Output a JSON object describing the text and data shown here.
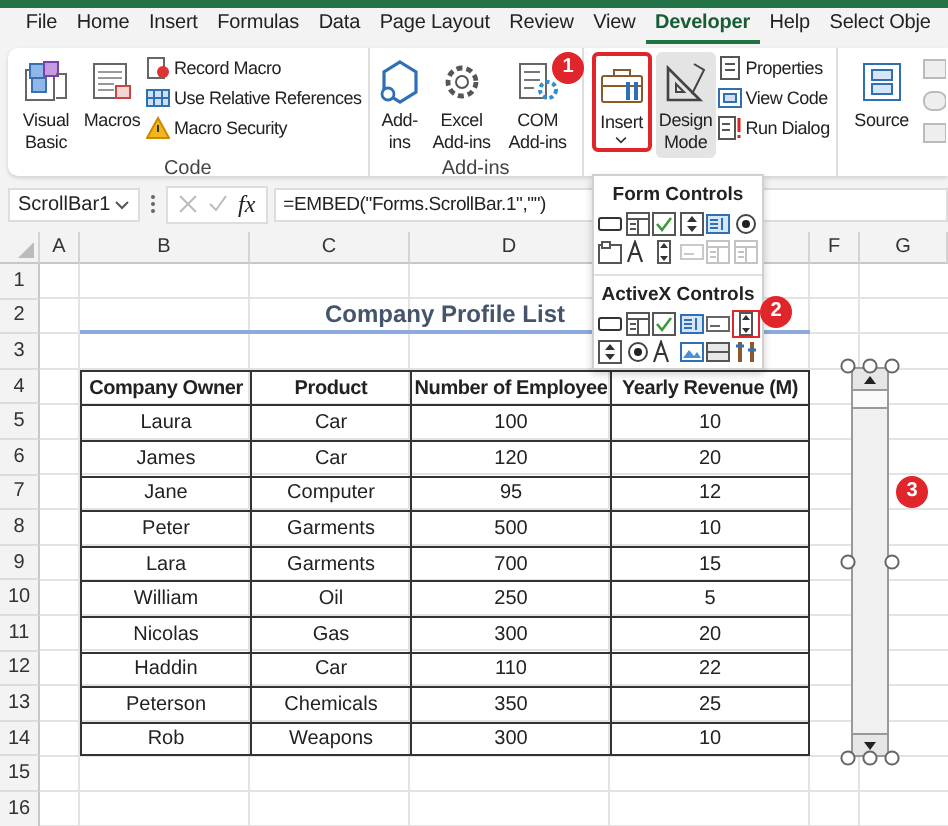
{
  "menu_tabs": [
    {
      "label": "File",
      "selected": false
    },
    {
      "label": "Home",
      "selected": false
    },
    {
      "label": "Insert",
      "selected": false
    },
    {
      "label": "Formulas",
      "selected": false
    },
    {
      "label": "Data",
      "selected": false
    },
    {
      "label": "Page Layout",
      "selected": false
    },
    {
      "label": "Review",
      "selected": false
    },
    {
      "label": "View",
      "selected": false
    },
    {
      "label": "Developer",
      "selected": true
    },
    {
      "label": "Help",
      "selected": false
    },
    {
      "label": "Select Obje",
      "selected": false
    }
  ],
  "ribbon_groups": [
    {
      "label": "Code",
      "large_buttons": [
        {
          "label": "Visual Basic"
        },
        {
          "label": "Macros"
        }
      ],
      "small_buttons": [
        {
          "label": "Record Macro"
        },
        {
          "label": "Use Relative References"
        },
        {
          "label": "Macro Security"
        }
      ]
    },
    {
      "label": "Add-ins",
      "large_buttons": [
        {
          "label": "Add-ins"
        },
        {
          "label": "Excel Add-ins"
        },
        {
          "label": "COM Add-ins"
        }
      ]
    },
    {
      "large_buttons": [
        {
          "label": "Insert",
          "dropdown": true,
          "highlighted": true,
          "selected": false
        },
        {
          "label": "Design Mode",
          "dropdown": false,
          "highlighted": false,
          "selected": true
        }
      ],
      "small_buttons": [
        {
          "label": "Properties"
        },
        {
          "label": "View Code"
        },
        {
          "label": "Run Dialog"
        }
      ]
    },
    {
      "large_buttons": [
        {
          "label": "Source"
        }
      ]
    }
  ],
  "formula_bar": {
    "name_box": "ScrollBar1",
    "function_label": "fx",
    "formula": "=EMBED(\"Forms.ScrollBar.1\",\"\")"
  },
  "sheet": {
    "column_headers": [
      "A",
      "B",
      "C",
      "D",
      "F",
      "G"
    ],
    "row_numbers": [
      "1",
      "2",
      "3",
      "4",
      "5",
      "6",
      "7",
      "8",
      "9",
      "10",
      "11",
      "12",
      "13",
      "14",
      "15",
      "16"
    ],
    "title": "Company Profile List",
    "table": {
      "columns": [
        "Company Owner",
        "Product",
        "Number of Employee",
        "Yearly Revenue (M)"
      ],
      "rows": [
        [
          "Laura",
          "Car",
          "100",
          "10"
        ],
        [
          "James",
          "Car",
          "120",
          "20"
        ],
        [
          "Jane",
          "Computer",
          "95",
          "12"
        ],
        [
          "Peter",
          "Garments",
          "500",
          "10"
        ],
        [
          "Lara",
          "Garments",
          "700",
          "15"
        ],
        [
          "William",
          "Oil",
          "250",
          "5"
        ],
        [
          "Nicolas",
          "Gas",
          "300",
          "20"
        ],
        [
          "Haddin",
          "Car",
          "110",
          "22"
        ],
        [
          "Peterson",
          "Chemicals",
          "350",
          "25"
        ],
        [
          "Rob",
          "Weapons",
          "300",
          "10"
        ]
      ]
    }
  },
  "scroll_bar": {
    "selected": true
  },
  "insert_menu": {
    "sections": [
      {
        "label": "Form Controls",
        "controls": [
          {
            "kind": "button",
            "disabled": false,
            "highlighted": false
          },
          {
            "kind": "combo-box",
            "disabled": false,
            "highlighted": false
          },
          {
            "kind": "check-box",
            "disabled": false,
            "highlighted": false
          },
          {
            "kind": "spin-button",
            "disabled": false,
            "highlighted": false
          },
          {
            "kind": "list-box",
            "disabled": false,
            "highlighted": false
          },
          {
            "kind": "option-button",
            "disabled": false,
            "highlighted": false
          },
          {
            "kind": "group-box",
            "disabled": false,
            "highlighted": false
          },
          {
            "kind": "label",
            "disabled": false,
            "highlighted": false
          },
          {
            "kind": "scroll-bar",
            "disabled": false,
            "highlighted": false
          },
          {
            "kind": "text-field",
            "disabled": true,
            "highlighted": false
          },
          {
            "kind": "combo-list",
            "disabled": true,
            "highlighted": false
          },
          {
            "kind": "combo-drop",
            "disabled": true,
            "highlighted": false
          }
        ]
      },
      {
        "label": "ActiveX Controls",
        "controls": [
          {
            "kind": "button",
            "disabled": false,
            "highlighted": false
          },
          {
            "kind": "combo-box",
            "disabled": false,
            "highlighted": false
          },
          {
            "kind": "check-box",
            "disabled": false,
            "highlighted": false
          },
          {
            "kind": "list-box",
            "disabled": false,
            "highlighted": false
          },
          {
            "kind": "text-field",
            "disabled": false,
            "highlighted": false
          },
          {
            "kind": "scroll-bar",
            "disabled": false,
            "highlighted": true
          },
          {
            "kind": "spin-button",
            "disabled": false,
            "highlighted": false
          },
          {
            "kind": "option-button",
            "disabled": false,
            "highlighted": false
          },
          {
            "kind": "label",
            "disabled": false,
            "highlighted": false
          },
          {
            "kind": "image",
            "disabled": false,
            "highlighted": false
          },
          {
            "kind": "toggle-button",
            "disabled": false,
            "highlighted": false
          },
          {
            "kind": "more-controls",
            "disabled": false,
            "highlighted": false
          }
        ]
      }
    ]
  },
  "annotations": [
    "1",
    "2",
    "3"
  ]
}
